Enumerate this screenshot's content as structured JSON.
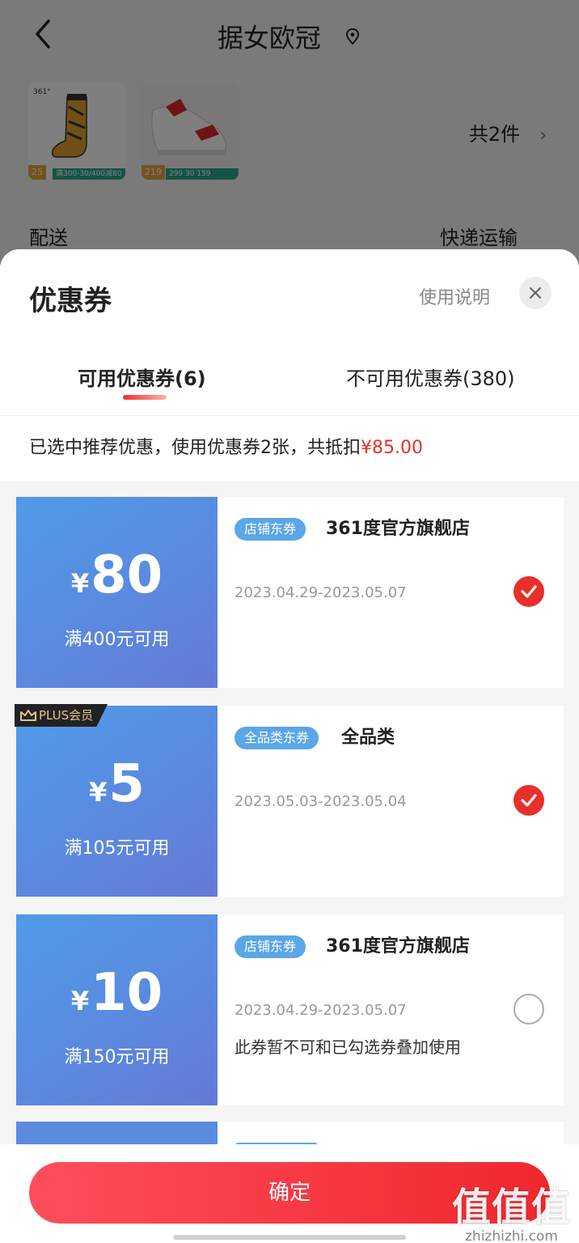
{
  "header": {
    "title": "据女欧冠",
    "back_icon": "back-icon",
    "location_icon": "location-pin-icon"
  },
  "products": [
    {
      "price": "25",
      "tag": "满300-30/400减80"
    },
    {
      "price": "219",
      "tag": "299  30  159"
    }
  ],
  "order": {
    "count": "共2件",
    "shipping_label": "配送",
    "shipping_value": "快递运输"
  },
  "sheet": {
    "title": "优惠券",
    "help_link": "使用说明",
    "close_icon": "close-icon",
    "tabs": [
      {
        "label": "可用优惠券(6)",
        "active": true
      },
      {
        "label": "不可用优惠券(380)",
        "active": false
      }
    ],
    "summary_text": "已选中推荐优惠，使用优惠券2张，共抵扣",
    "summary_amount": "¥85.00"
  },
  "coupons": [
    {
      "currency": "¥",
      "amount": "80",
      "condition": "满400元可用",
      "badge": "店铺东券",
      "shop": "361度官方旗舰店",
      "date": "2023.04.29-2023.05.07",
      "note": "",
      "selected": true
    },
    {
      "plus_label": "PLUS会员",
      "currency": "¥",
      "amount": "5",
      "condition": "满105元可用",
      "badge": "全品类东券",
      "shop": "全品类",
      "date": "2023.05.03-2023.05.04",
      "note": "",
      "selected": true
    },
    {
      "currency": "¥",
      "amount": "10",
      "condition": "满150元可用",
      "badge": "店铺东券",
      "shop": "361度官方旗舰店",
      "date": "2023.04.29-2023.05.07",
      "note": "此券暂不可和已勾选券叠加使用",
      "selected": false
    }
  ],
  "footer": {
    "confirm": "确定"
  },
  "watermark": {
    "logo": "值值值",
    "url": "zhizhizhi.com"
  },
  "colors": {
    "accent_red": "#e8302a",
    "coupon_blue": "#5a8be0",
    "badge_blue": "#5aa6e6"
  }
}
